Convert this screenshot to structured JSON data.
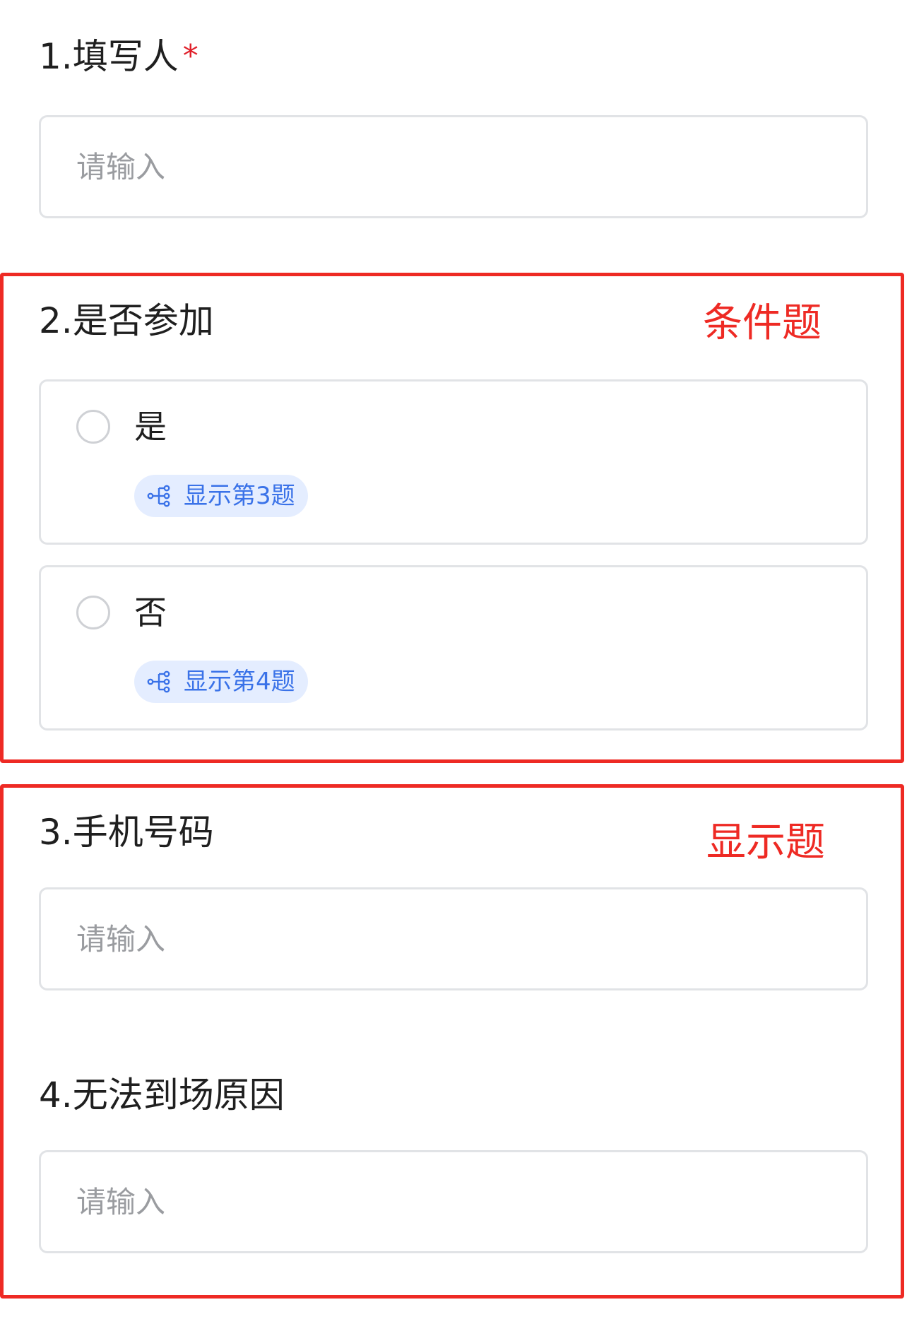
{
  "questions": [
    {
      "title": "1.填写人",
      "required_mark": "*",
      "placeholder": "请输入"
    },
    {
      "title": "2.是否参加",
      "options": [
        {
          "label": "是",
          "logic_tag": "显示第3题"
        },
        {
          "label": "否",
          "logic_tag": "显示第4题"
        }
      ]
    },
    {
      "title": "3.手机号码",
      "placeholder": "请输入"
    },
    {
      "title": "4.无法到场原因",
      "placeholder": "请输入"
    }
  ],
  "annotations": {
    "condition_label": "条件题",
    "display_label": "显示题"
  },
  "colors": {
    "annotation_red": "#ee2a24",
    "required_red": "#e0202a",
    "tag_blue": "#3a72e8",
    "tag_bg": "#e4edff",
    "border_gray": "#e1e3e6",
    "placeholder_gray": "#9a9ca0"
  },
  "icons": {
    "logic_tag_icon": "branch-logic-icon"
  }
}
